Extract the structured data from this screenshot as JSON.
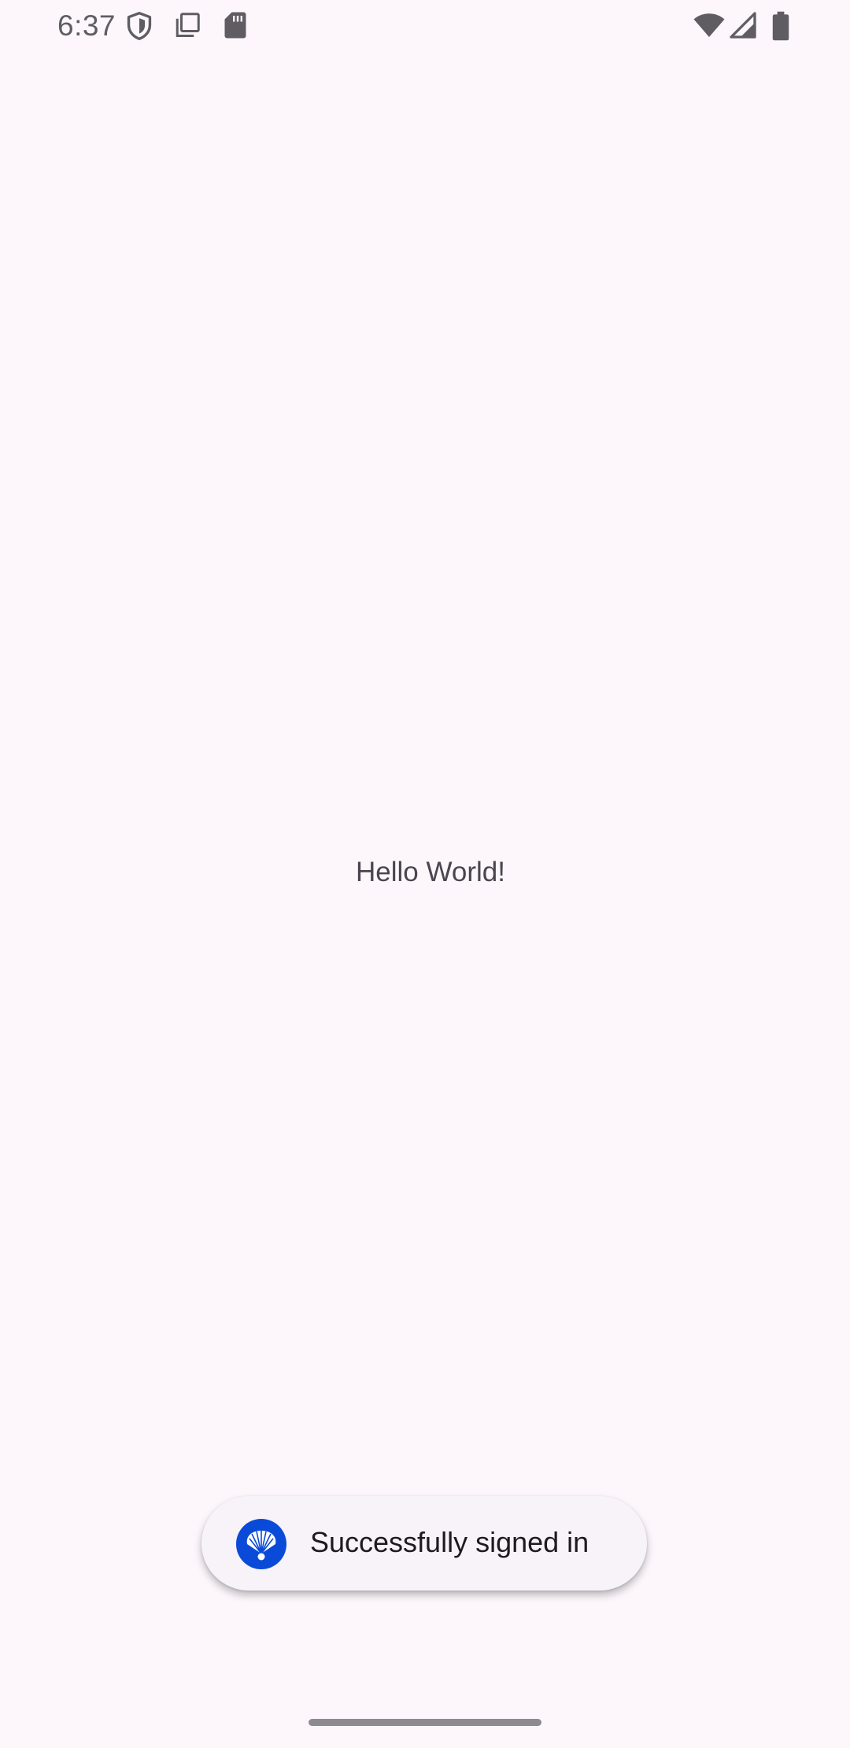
{
  "status_bar": {
    "time": "6:37",
    "icons": [
      "shield-icon",
      "copy-icon",
      "sd-card-icon",
      "wifi-icon",
      "signal-icon",
      "battery-icon"
    ],
    "icon_color": "#5f5d62"
  },
  "main": {
    "greeting": "Hello World!"
  },
  "toast": {
    "app_icon": "shell-icon",
    "message": "Successfully signed in",
    "icon_color": "#0a4ad8"
  },
  "theme": {
    "background": "#fdf7fc"
  }
}
